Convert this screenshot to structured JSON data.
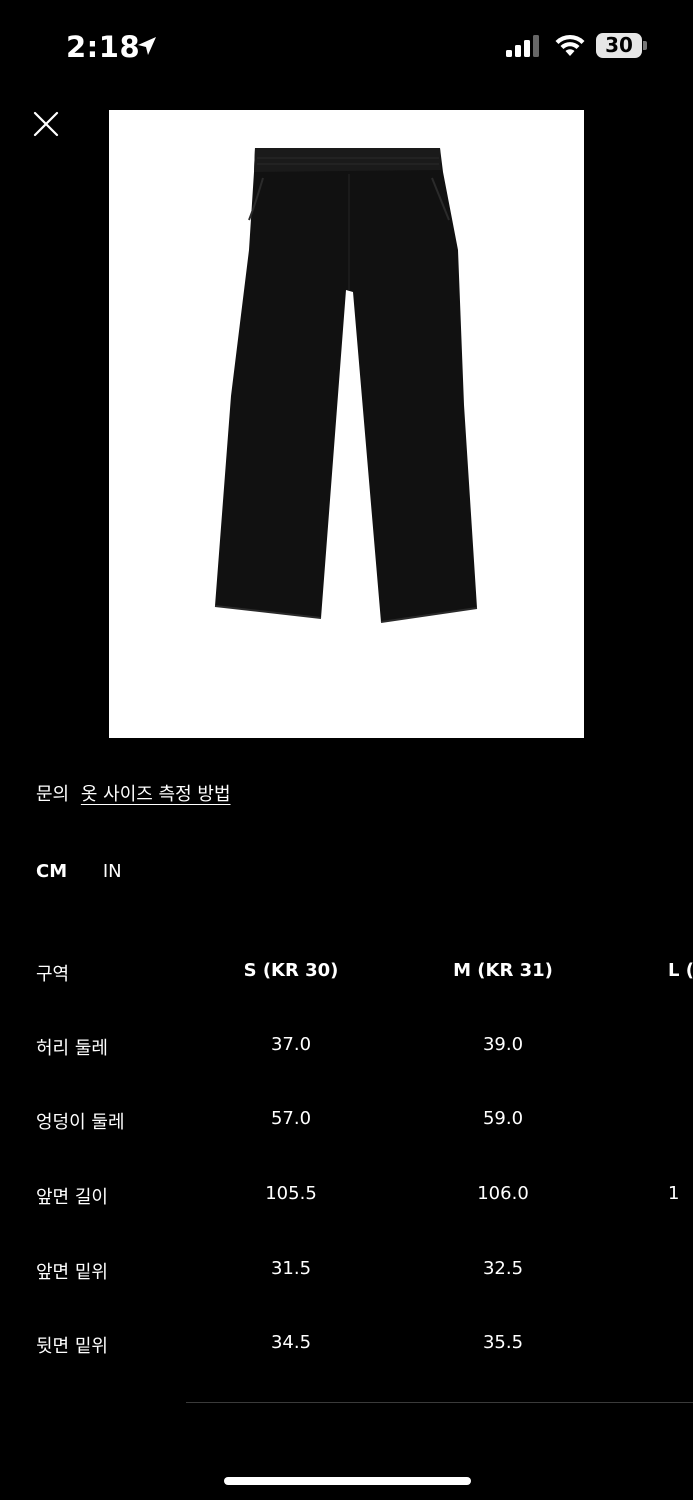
{
  "status_bar": {
    "time": "2:18",
    "battery": "30"
  },
  "help": {
    "prefix": "문의",
    "link_label": "옷 사이즈 측정 방법"
  },
  "unit_tabs": [
    {
      "label": "CM",
      "active": true
    },
    {
      "label": "IN",
      "active": false
    }
  ],
  "size_table": {
    "headers": [
      "구역",
      "S (KR 30)",
      "M (KR 31)",
      "L ("
    ],
    "rows": [
      {
        "label": "허리 둘레",
        "values": [
          "37.0",
          "39.0",
          ""
        ]
      },
      {
        "label": "엉덩이 둘레",
        "values": [
          "57.0",
          "59.0",
          ""
        ]
      },
      {
        "label": "앞면 길이",
        "values": [
          "105.5",
          "106.0",
          "1"
        ]
      },
      {
        "label": "앞면 밑위",
        "values": [
          "31.5",
          "32.5",
          ""
        ]
      },
      {
        "label": "뒷면 밑위",
        "values": [
          "34.5",
          "35.5",
          ""
        ]
      }
    ]
  }
}
